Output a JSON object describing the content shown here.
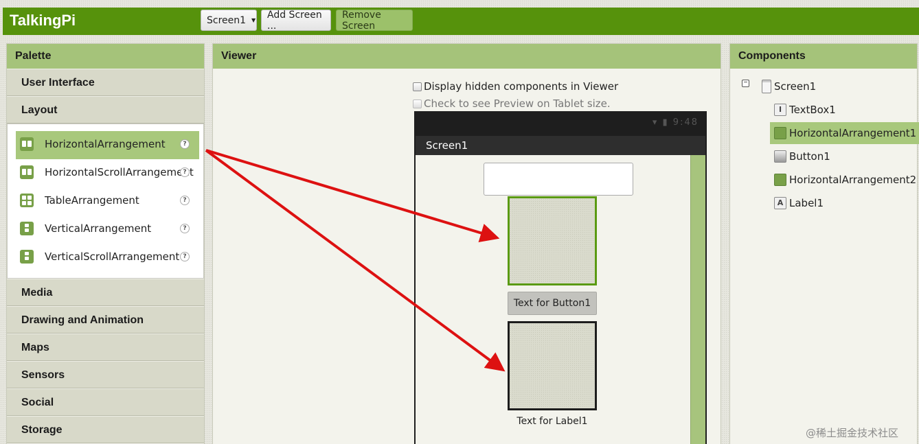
{
  "app": {
    "title": "TalkingPi",
    "screen_select": "Screen1",
    "add_screen": "Add Screen ...",
    "remove_screen": "Remove Screen"
  },
  "palette": {
    "header": "Palette",
    "categories_top": [
      "User Interface",
      "Layout"
    ],
    "layout_items": [
      {
        "label": "HorizontalArrangement",
        "icon": "horizontal-arrangement-icon",
        "selected": true
      },
      {
        "label": "HorizontalScrollArrangement",
        "icon": "horizontal-scroll-arrangement-icon"
      },
      {
        "label": "TableArrangement",
        "icon": "table-arrangement-icon"
      },
      {
        "label": "VerticalArrangement",
        "icon": "vertical-arrangement-icon"
      },
      {
        "label": "VerticalScrollArrangement",
        "icon": "vertical-scroll-arrangement-icon"
      }
    ],
    "help_glyph": "?",
    "categories_bottom": [
      "Media",
      "Drawing and Animation",
      "Maps",
      "Sensors",
      "Social",
      "Storage"
    ]
  },
  "viewer": {
    "header": "Viewer",
    "display_hidden": "Display hidden components in Viewer",
    "tablet_preview": "Check to see Preview on Tablet size.",
    "status_icons": "▾ ▮ 9:48",
    "screen_title": "Screen1",
    "button_text": "Text for Button1",
    "label_text": "Text for Label1"
  },
  "components": {
    "header": "Components",
    "collapse_glyph": "−",
    "tree": [
      {
        "label": "Screen1",
        "icon": "screen-icon"
      },
      {
        "label": "TextBox1",
        "icon": "textbox-icon",
        "glyph": "I"
      },
      {
        "label": "HorizontalArrangement1",
        "icon": "horizontal-arrangement-icon",
        "selected": true
      },
      {
        "label": "Button1",
        "icon": "button-icon"
      },
      {
        "label": "HorizontalArrangement2",
        "icon": "horizontal-arrangement-icon"
      },
      {
        "label": "Label1",
        "icon": "label-icon",
        "glyph": "A"
      }
    ]
  },
  "watermark": "@稀土掘金技术社区",
  "colors": {
    "topbar": "#56920c",
    "panel_header": "#a5c37a",
    "selection": "#a8c87c",
    "arrow": "#dd1111"
  }
}
